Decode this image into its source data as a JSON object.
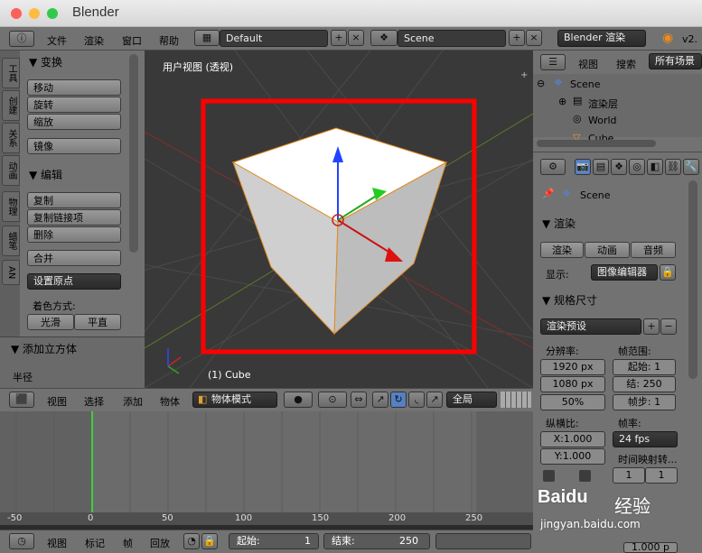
{
  "window": {
    "title": "Blender"
  },
  "menu": {
    "file": "文件",
    "render": "渲染",
    "window": "窗口",
    "help": "帮助",
    "layout": "Default",
    "scene": "Scene",
    "engine": "Blender 渲染",
    "version": "v2."
  },
  "toolshelf": {
    "tabs": [
      "工具",
      "创建",
      "关系",
      "动画",
      "物理",
      "蜡笔",
      "AN"
    ],
    "transform": "▼ 变换",
    "move": "移动",
    "rotate": "旋转",
    "scale": "缩放",
    "mirror": "镜像",
    "edit": "▼ 编辑",
    "duplicate": "复制",
    "duplicate_linked": "复制链接项",
    "delete": "删除",
    "join": "合并",
    "set_origin": "设置原点",
    "shading": "着色方式:",
    "smooth": "光滑",
    "flat": "平直",
    "add_cube": "▼ 添加立方体",
    "radius": "半径"
  },
  "viewport": {
    "label": "用户视图 (透视)",
    "object": "(1) Cube"
  },
  "view3d_header": {
    "view": "视图",
    "select": "选择",
    "add": "添加",
    "object": "物体",
    "mode": "物体模式",
    "global": "全局"
  },
  "timeline": {
    "ticks": [
      "-50",
      "0",
      "50",
      "100",
      "150",
      "200",
      "250"
    ],
    "view": "视图",
    "marker": "标记",
    "frame": "帧",
    "playback": "回放",
    "start_label": "起始:",
    "start": "1",
    "end_label": "结束:",
    "end": "250"
  },
  "outliner": {
    "view": "视图",
    "search": "搜索",
    "all_scenes": "所有场景",
    "scene": "Scene",
    "render_layers": "渲染层",
    "world": "World",
    "cube": "Cube"
  },
  "properties": {
    "scene": "Scene",
    "render": "▼ 渲染",
    "render_btn": "渲染",
    "anim_btn": "动画",
    "audio_btn": "音频",
    "display_label": "显示:",
    "display": "图像编辑器",
    "dimensions": "▼ 规格尺寸",
    "presets": "渲染预设",
    "resolution": "分辨率:",
    "res_x": "1920 px",
    "res_y": "1080 px",
    "res_pct": "50%",
    "frame_range": "帧范围:",
    "start": "起始:",
    "start_val": "1",
    "end": "结:",
    "end_val": "250",
    "step": "帧步:",
    "step_val": "1",
    "aspect": "纵横比:",
    "ax": "X:1.000",
    "ay": "Y:1.000",
    "fps_label": "帧率:",
    "fps": "24 fps",
    "time_remap": "时间映射转...",
    "tr_a": "1",
    "tr_b": "1",
    "bottom_val": "1.000 p"
  },
  "watermark": {
    "brand": "Baidu",
    "jy": "经验",
    "url": "jingyan.baidu.com"
  },
  "colors": {
    "highlight": "#ff0000",
    "accent": "#5680c2"
  }
}
